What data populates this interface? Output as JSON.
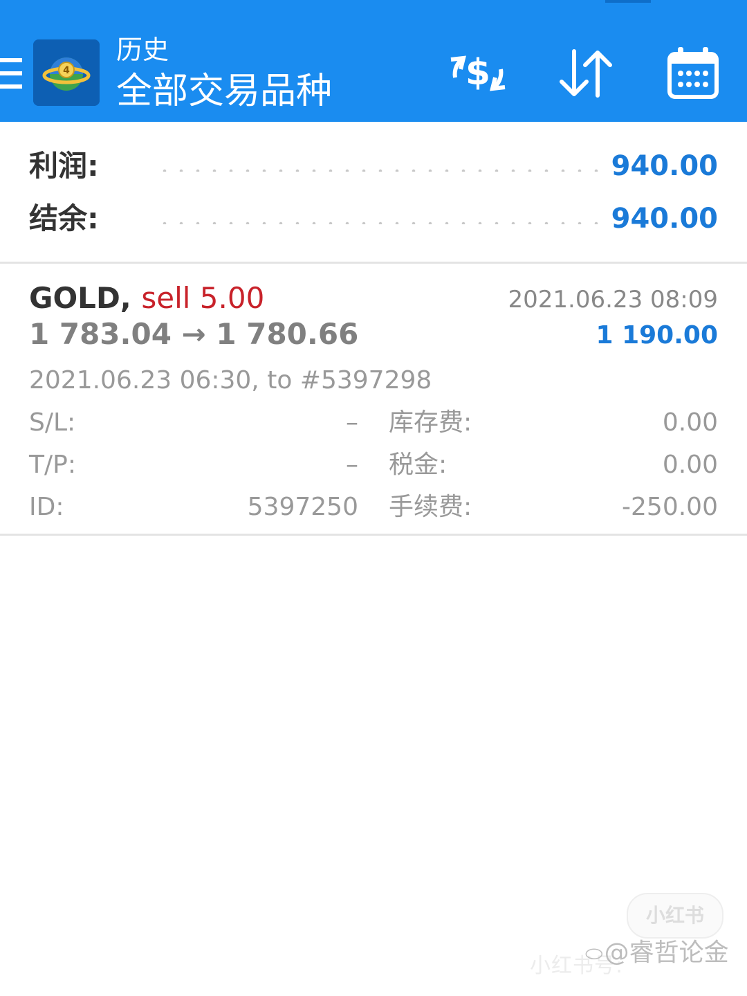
{
  "header": {
    "title_small": "历史",
    "title_main": "全部交易品种",
    "icons": [
      "menu-icon",
      "app-logo",
      "currency-exchange-icon",
      "sort-icon",
      "calendar-icon"
    ]
  },
  "summary": {
    "profit_label": "利润:",
    "profit_value": "940.00",
    "balance_label": "结余:",
    "balance_value": "940.00"
  },
  "deal": {
    "symbol": "GOLD,",
    "type": "sell 5.00",
    "close_time": "2021.06.23 08:09",
    "price_open": "1 783.04",
    "arrow": "→",
    "price_close": "1 780.66",
    "profit": "1 190.00",
    "open_info": "2021.06.23 06:30, to #5397298",
    "sl_label": "S/L:",
    "sl_value": "–",
    "tp_label": "T/P:",
    "tp_value": "–",
    "id_label": "ID:",
    "id_value": "5397250",
    "swap_label": "库存费:",
    "swap_value": "0.00",
    "tax_label": "税金:",
    "tax_value": "0.00",
    "commission_label": "手续费:",
    "commission_value": "-250.00"
  },
  "watermark": {
    "badge": "小红书",
    "faint_id": "小红书号:",
    "user": "@睿哲论金"
  },
  "colors": {
    "header_bg": "#1a8cf0",
    "value_blue": "#1a7ad8",
    "sell_red": "#c8222a"
  }
}
